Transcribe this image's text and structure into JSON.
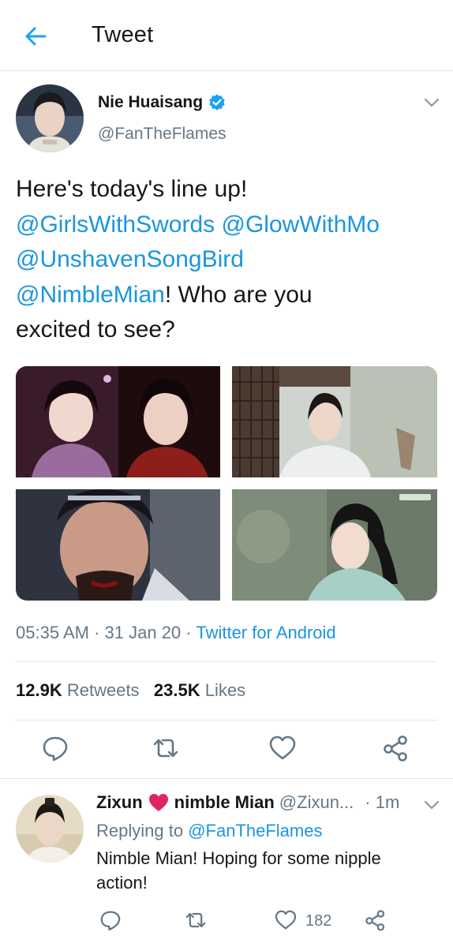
{
  "header": {
    "title": "Tweet"
  },
  "tweet": {
    "display_name": "Nie Huaisang",
    "handle": "@FanTheFlames",
    "text": {
      "line1": "Here's today's line up!",
      "mention1": "@GirlsWithSwords",
      "mention2": "@GlowWithMo",
      "mention3": "@UnshavenSongBird",
      "mention4": "@NimbleMian",
      "line4_rest": "! Who are you",
      "line5": "excited to see?"
    },
    "time": "05:35 AM",
    "sep": "·",
    "date": "31 Jan 20",
    "source": "Twitter for Android",
    "retweets_count": "12.9K",
    "retweets_label": "Retweets",
    "likes_count": "23.5K",
    "likes_label": "Likes"
  },
  "reply": {
    "name_part1": "Zixun",
    "name_part2": "nimble Mian",
    "handle": "@Zixun...",
    "time": "· 1m",
    "replying_prefix": "Replying to",
    "replying_to": "@FanTheFlames",
    "text": "Nimble Mian! Hoping for some nipple action!",
    "like_count": "182"
  },
  "colors": {
    "accent": "#1da1f2",
    "link": "#1b95e0",
    "secondary_text": "#657786",
    "like_heart": "#e0245e"
  },
  "icons": {
    "back": "arrow-left-icon",
    "verified": "verified-badge-icon",
    "more": "chevron-down-icon",
    "reply": "comment-icon",
    "retweet": "retweet-icon",
    "like": "heart-icon",
    "share": "share-icon",
    "emoji": "red-heart-emoji"
  }
}
